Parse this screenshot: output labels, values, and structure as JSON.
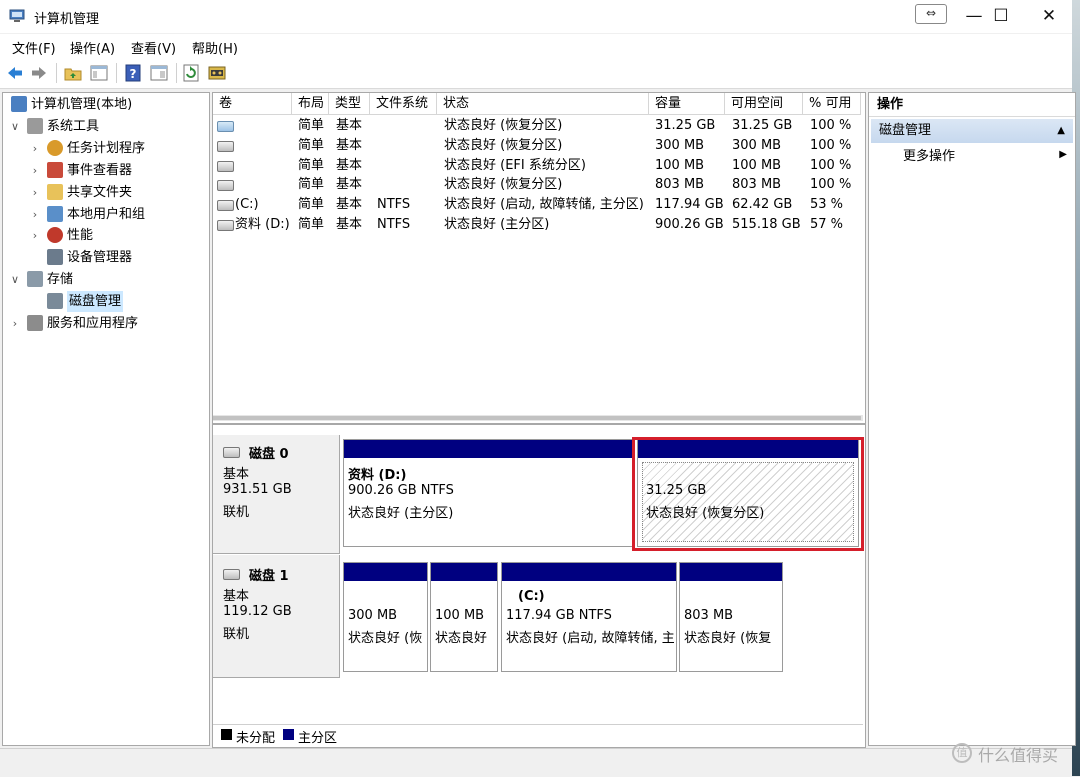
{
  "window": {
    "title": "计算机管理",
    "controls": {
      "minimize": "—",
      "maximize": "☐",
      "close": "✕",
      "snap": "⇔"
    }
  },
  "menubar": {
    "items": [
      "文件(F)",
      "操作(A)",
      "查看(V)",
      "帮助(H)"
    ]
  },
  "toolbar": {
    "icons": [
      "back-arrow",
      "forward-arrow",
      "up-folder",
      "show-hide-tree",
      "help",
      "properties",
      "refresh",
      "settings"
    ]
  },
  "tree": {
    "items": [
      {
        "label": "计算机管理(本地)",
        "level": 0,
        "expander": "",
        "icon": "computer"
      },
      {
        "label": "系统工具",
        "level": 1,
        "expander": "∨",
        "icon": "tools"
      },
      {
        "label": "任务计划程序",
        "level": 2,
        "expander": "›",
        "icon": "clock"
      },
      {
        "label": "事件查看器",
        "level": 2,
        "expander": "›",
        "icon": "event-log"
      },
      {
        "label": "共享文件夹",
        "level": 2,
        "expander": "›",
        "icon": "shared-folder"
      },
      {
        "label": "本地用户和组",
        "level": 2,
        "expander": "›",
        "icon": "users"
      },
      {
        "label": "性能",
        "level": 2,
        "expander": "›",
        "icon": "performance"
      },
      {
        "label": "设备管理器",
        "level": 2,
        "expander": "",
        "icon": "device-manager"
      },
      {
        "label": "存储",
        "level": 1,
        "expander": "∨",
        "icon": "storage"
      },
      {
        "label": "磁盘管理",
        "level": 2,
        "expander": "",
        "icon": "disk-management",
        "selected": true
      },
      {
        "label": "服务和应用程序",
        "level": 1,
        "expander": "›",
        "icon": "services"
      }
    ]
  },
  "volumes": {
    "columns": [
      "卷",
      "布局",
      "类型",
      "文件系统",
      "状态",
      "容量",
      "可用空间",
      "% 可用"
    ],
    "rows": [
      [
        "",
        "简单",
        "基本",
        "",
        "状态良好 (恢复分区)",
        "31.25 GB",
        "31.25 GB",
        "100 %"
      ],
      [
        "",
        "简单",
        "基本",
        "",
        "状态良好 (恢复分区)",
        "300 MB",
        "300 MB",
        "100 %"
      ],
      [
        "",
        "简单",
        "基本",
        "",
        "状态良好 (EFI 系统分区)",
        "100 MB",
        "100 MB",
        "100 %"
      ],
      [
        "",
        "简单",
        "基本",
        "",
        "状态良好 (恢复分区)",
        "803 MB",
        "803 MB",
        "100 %"
      ],
      [
        "(C:)",
        "简单",
        "基本",
        "NTFS",
        "状态良好 (启动, 故障转储, 主分区)",
        "117.94 GB",
        "62.42 GB",
        "53 %"
      ],
      [
        "资料 (D:)",
        "简单",
        "基本",
        "NTFS",
        "状态良好 (主分区)",
        "900.26 GB",
        "515.18 GB",
        "57 %"
      ]
    ]
  },
  "disks": [
    {
      "name": "磁盘 0",
      "type": "基本",
      "size": "931.51 GB",
      "status": "联机",
      "partitions": [
        {
          "title": "资料  (D:)",
          "line1": "900.26 GB NTFS",
          "line2": "状态良好 (主分区)"
        },
        {
          "title": "",
          "line1": "31.25 GB",
          "line2": "状态良好 (恢复分区)",
          "hatched": true
        }
      ]
    },
    {
      "name": "磁盘 1",
      "type": "基本",
      "size": "119.12 GB",
      "status": "联机",
      "partitions": [
        {
          "title": "",
          "line1": "300 MB",
          "line2": "状态良好 (恢"
        },
        {
          "title": "",
          "line1": "100 MB",
          "line2": "状态良好"
        },
        {
          "title": "(C:)",
          "line1": "117.94 GB NTFS",
          "line2": "状态良好 (启动, 故障转储, 主"
        },
        {
          "title": "",
          "line1": "803 MB",
          "line2": "状态良好 (恢复"
        }
      ]
    }
  ],
  "legend": [
    {
      "label": "未分配",
      "color": "#000000"
    },
    {
      "label": "主分区",
      "color": "#000080"
    }
  ],
  "actions": {
    "header": "操作",
    "section": "磁盘管理",
    "section_arrow": "▲",
    "more": "更多操作",
    "more_arrow": "▶"
  },
  "watermark": {
    "text": "什么值得买",
    "symbol": "值"
  },
  "colors": {
    "partition_bar": "#000080",
    "highlight": "#d51f2b",
    "selection": "#cce8ff"
  }
}
